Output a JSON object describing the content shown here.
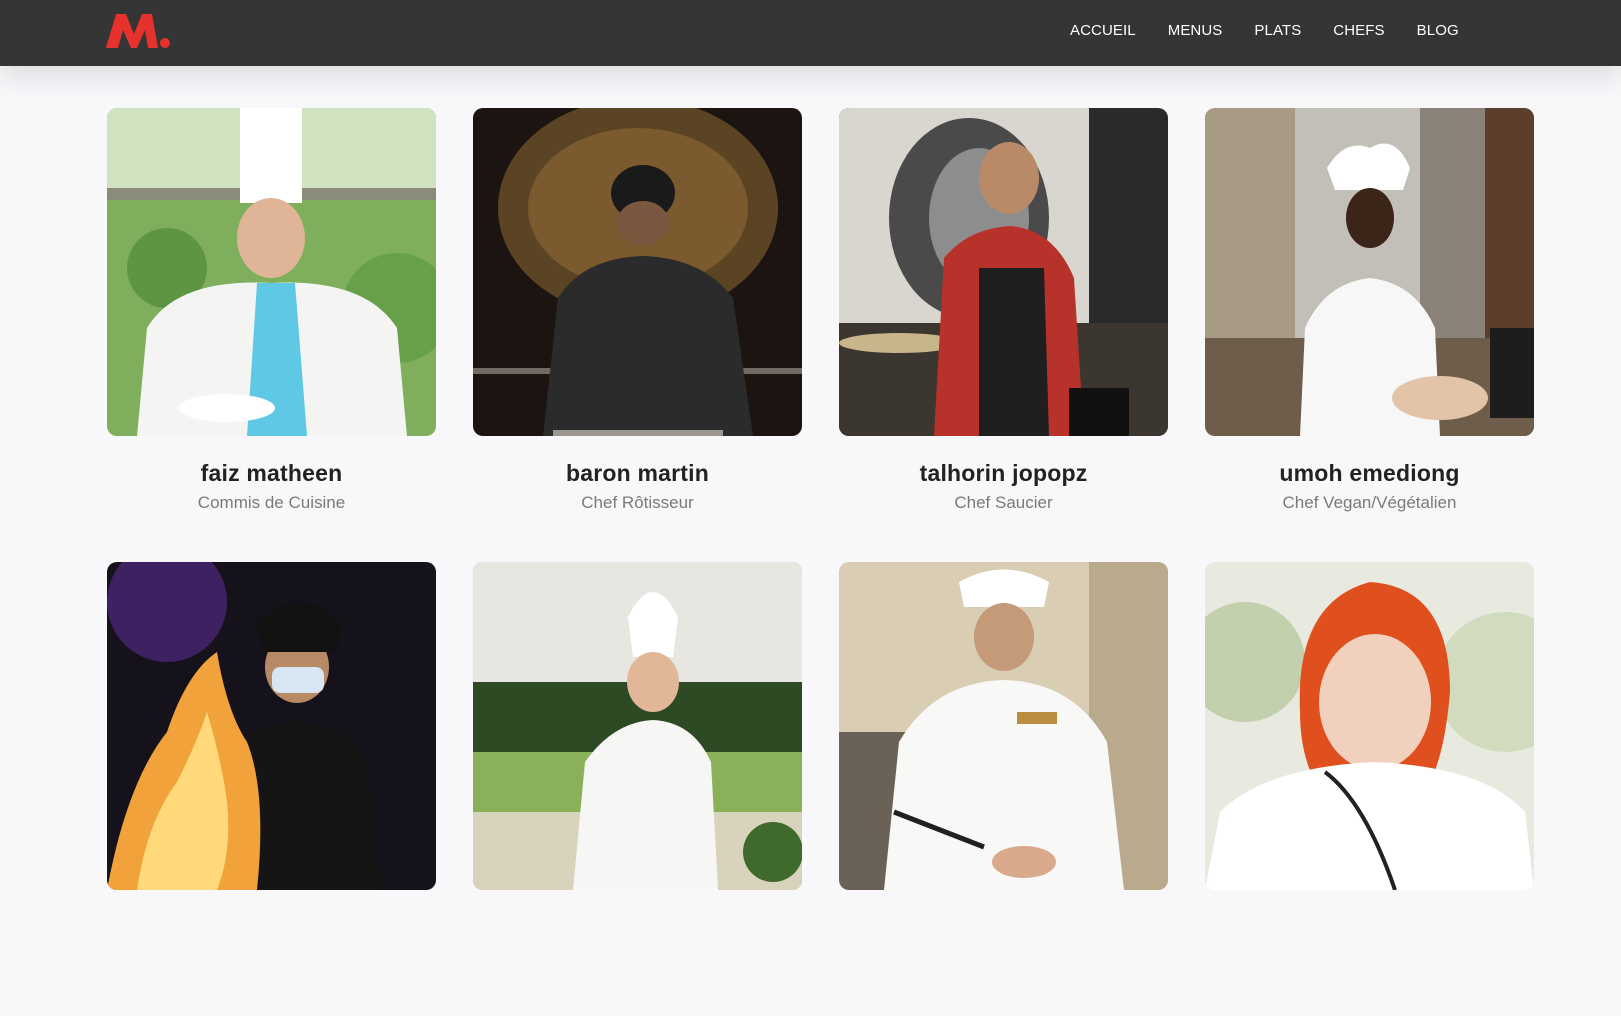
{
  "brand": {
    "logo_text": "M.",
    "accent_color": "#e5322d"
  },
  "nav": {
    "items": [
      "ACCUEIL",
      "MENUS",
      "PLATS",
      "CHEFS",
      "BLOG"
    ]
  },
  "chefs": [
    {
      "name": "faiz matheen",
      "role": "Commis de Cuisine"
    },
    {
      "name": "baron martin",
      "role": "Chef Rôtisseur"
    },
    {
      "name": "talhorin jopopz",
      "role": "Chef Saucier"
    },
    {
      "name": "umoh emediong",
      "role": "Chef Vegan/Végétalien"
    },
    {
      "name": "",
      "role": ""
    },
    {
      "name": "",
      "role": ""
    },
    {
      "name": "",
      "role": ""
    },
    {
      "name": "",
      "role": ""
    }
  ]
}
